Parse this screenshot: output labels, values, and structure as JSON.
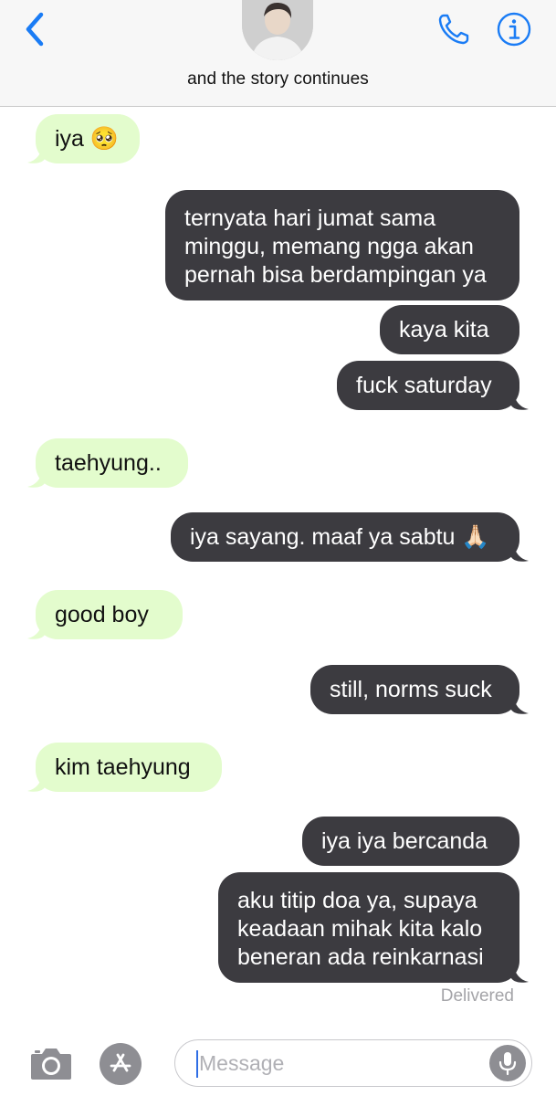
{
  "header": {
    "contact_name": "and the story continues",
    "back_icon": "chevron-left-icon",
    "call_icon": "phone-icon",
    "info_icon": "info-icon"
  },
  "colors": {
    "accent": "#1a7cf5",
    "incoming_bubble": "#e3fccd",
    "outgoing_bubble": "#3c3b40",
    "outgoing_text": "#ffffff",
    "delivered_text": "#a4a4a8"
  },
  "messages": [
    {
      "direction": "in",
      "lines": [
        "iya 🥺"
      ]
    },
    {
      "direction": "out",
      "lines": [
        "ternyata hari jumat sama",
        "minggu, memang ngga akan",
        "pernah bisa berdampingan ya"
      ]
    },
    {
      "direction": "out",
      "lines": [
        "kaya kita"
      ]
    },
    {
      "direction": "out",
      "lines": [
        "fuck saturday"
      ]
    },
    {
      "direction": "in",
      "lines": [
        "taehyung.."
      ]
    },
    {
      "direction": "out",
      "lines": [
        "iya sayang. maaf ya sabtu 🙏🏻"
      ]
    },
    {
      "direction": "in",
      "lines": [
        "good boy"
      ]
    },
    {
      "direction": "out",
      "lines": [
        "still, norms suck"
      ]
    },
    {
      "direction": "in",
      "lines": [
        "kim taehyung"
      ]
    },
    {
      "direction": "out",
      "lines": [
        "iya iya bercanda"
      ]
    },
    {
      "direction": "out",
      "lines": [
        "aku titip doa ya, supaya",
        "keadaan mihak kita kalo",
        "beneran ada reinkarnasi"
      ]
    }
  ],
  "status": {
    "delivered": "Delivered"
  },
  "input_bar": {
    "placeholder": "Message",
    "camera_icon": "camera-icon",
    "apps_icon": "app-store-icon",
    "mic_icon": "microphone-icon"
  }
}
